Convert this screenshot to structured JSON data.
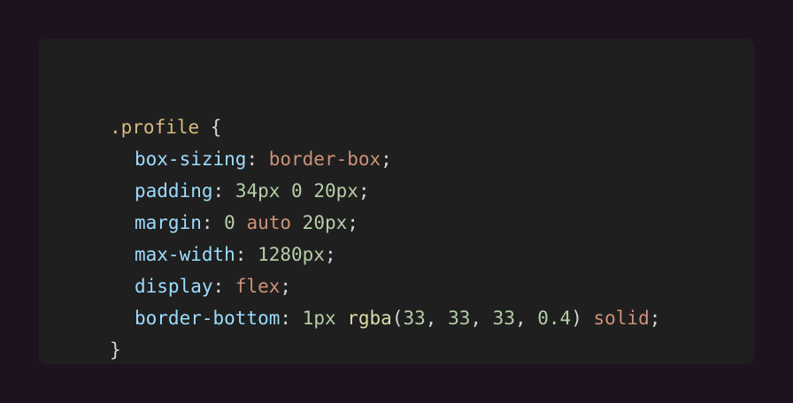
{
  "colors": {
    "page_background": "#1e1220",
    "editor_background": "#1f1f1f",
    "selector": "#d7ba7d",
    "property": "#9cdcfe",
    "number": "#b5cea8",
    "keyword": "#ce9178",
    "function": "#dcdcaa",
    "punctuation": "#d4d4d4"
  },
  "code": {
    "selector": ".profile",
    "open_brace": " {",
    "close_brace": "}",
    "rules": [
      {
        "property": "box-sizing",
        "colon": ": ",
        "value": [
          {
            "text": "border-box",
            "kind": "keyword"
          },
          {
            "text": ";",
            "kind": "punct"
          }
        ]
      },
      {
        "property": "padding",
        "colon": ": ",
        "value": [
          {
            "text": "34px 0 20px",
            "kind": "num"
          },
          {
            "text": ";",
            "kind": "punct"
          }
        ]
      },
      {
        "property": "margin",
        "colon": ": ",
        "value": [
          {
            "text": "0 ",
            "kind": "num"
          },
          {
            "text": "auto",
            "kind": "keyword"
          },
          {
            "text": " 20px",
            "kind": "num"
          },
          {
            "text": ";",
            "kind": "punct"
          }
        ]
      },
      {
        "property": "max-width",
        "colon": ": ",
        "value": [
          {
            "text": "1280px",
            "kind": "num"
          },
          {
            "text": ";",
            "kind": "punct"
          }
        ]
      },
      {
        "property": "display",
        "colon": ": ",
        "value": [
          {
            "text": "flex",
            "kind": "keyword"
          },
          {
            "text": ";",
            "kind": "punct"
          }
        ]
      },
      {
        "property": "border-bottom",
        "colon": ": ",
        "value": [
          {
            "text": "1px ",
            "kind": "num"
          },
          {
            "text": "rgba",
            "kind": "func"
          },
          {
            "text": "(",
            "kind": "punct"
          },
          {
            "text": "33",
            "kind": "num"
          },
          {
            "text": ", ",
            "kind": "punct"
          },
          {
            "text": "33",
            "kind": "num"
          },
          {
            "text": ", ",
            "kind": "punct"
          },
          {
            "text": "33",
            "kind": "num"
          },
          {
            "text": ", ",
            "kind": "punct"
          },
          {
            "text": "0.4",
            "kind": "num"
          },
          {
            "text": ") ",
            "kind": "punct"
          },
          {
            "text": "solid",
            "kind": "keyword"
          },
          {
            "text": ";",
            "kind": "punct"
          }
        ]
      }
    ]
  }
}
